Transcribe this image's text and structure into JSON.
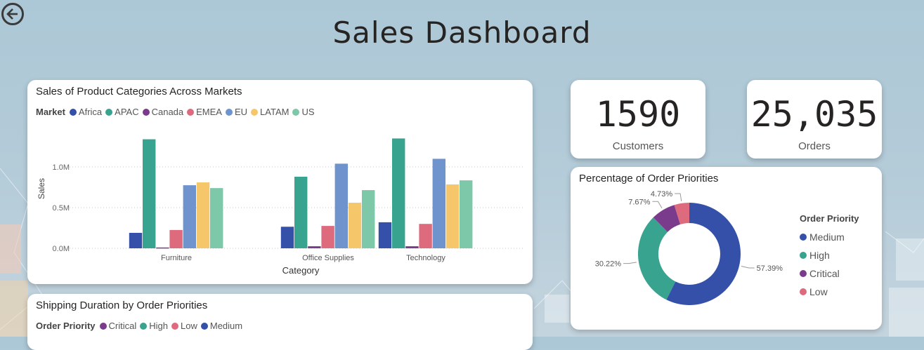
{
  "header": {
    "title": "Sales Dashboard",
    "back_icon": "back-arrow-icon"
  },
  "colors": {
    "Africa": "#3450a8",
    "APAC": "#38a38e",
    "Canada": "#7b3b8c",
    "EMEA": "#de6b7d",
    "EU": "#6e93cd",
    "LATAM": "#f5c76a",
    "US": "#7cc8a8",
    "Medium": "#3450a8",
    "High": "#38a38e",
    "Critical": "#7b3b8c",
    "Low": "#de6b7d"
  },
  "sales_chart": {
    "title": "Sales of Product Categories Across Markets",
    "legend_title": "Market",
    "markets": [
      "Africa",
      "APAC",
      "Canada",
      "EMEA",
      "EU",
      "LATAM",
      "US"
    ],
    "x_title": "Category",
    "y_title": "Sales",
    "y_ticks": [
      "1.0M",
      "0.5M",
      "0.0M"
    ]
  },
  "kpis": {
    "customers": {
      "value": "1590",
      "label": "Customers"
    },
    "orders": {
      "value": "25,035",
      "label": "Orders"
    }
  },
  "priority_chart": {
    "title": "Percentage of Order Priorities",
    "legend_title": "Order Priority",
    "items": [
      "Medium",
      "High",
      "Critical",
      "Low"
    ],
    "labels": [
      "57.39%",
      "30.22%",
      "7.67%",
      "4.73%"
    ]
  },
  "shipping_chart": {
    "title": "Shipping Duration by Order Priorities",
    "legend_title": "Order Priority",
    "items": [
      "Critical",
      "High",
      "Low",
      "Medium"
    ]
  },
  "chart_data": [
    {
      "type": "bar",
      "title": "Sales of Product Categories Across Markets",
      "xlabel": "Category",
      "ylabel": "Sales",
      "categories": [
        "Furniture",
        "Office Supplies",
        "Technology"
      ],
      "ylim": [
        0,
        1500000
      ],
      "grid": true,
      "legend": "top-left",
      "series": [
        {
          "name": "Africa",
          "values": [
            190000,
            265000,
            320000
          ]
        },
        {
          "name": "APAC",
          "values": [
            1340000,
            880000,
            1350000
          ]
        },
        {
          "name": "Canada",
          "values": [
            10000,
            25000,
            25000
          ]
        },
        {
          "name": "EMEA",
          "values": [
            225000,
            275000,
            300000
          ]
        },
        {
          "name": "EU",
          "values": [
            775000,
            1040000,
            1100000
          ]
        },
        {
          "name": "LATAM",
          "values": [
            810000,
            560000,
            785000
          ]
        },
        {
          "name": "US",
          "values": [
            740000,
            715000,
            835000
          ]
        }
      ]
    },
    {
      "type": "pie",
      "title": "Percentage of Order Priorities",
      "legend": "right",
      "categories": [
        "Medium",
        "High",
        "Critical",
        "Low"
      ],
      "values": [
        57.39,
        30.22,
        7.67,
        4.73
      ]
    }
  ]
}
